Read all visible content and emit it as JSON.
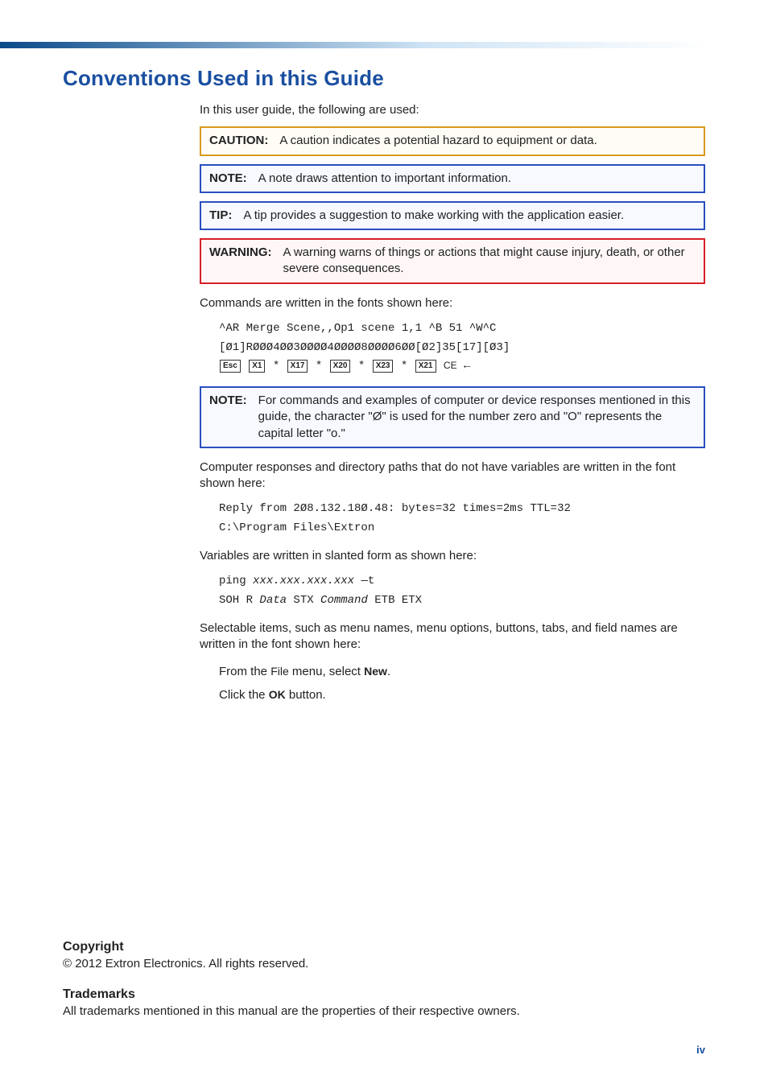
{
  "heading": "Conventions Used in this Guide",
  "intro": "In this user guide, the following are used:",
  "callouts": {
    "caution_label": "CAUTION:",
    "caution_text": "A caution indicates a potential hazard to equipment or data.",
    "note1_label": "NOTE:",
    "note1_text": "A note draws attention to important information.",
    "tip_label": "TIP:",
    "tip_text": "A tip provides a suggestion to make working with the application easier.",
    "warning_label": "WARNING:",
    "warning_text": "A warning warns of things or actions that might cause injury, death, or other severe consequences."
  },
  "commands_intro": "Commands are written in the fonts shown here:",
  "command_line1": "^AR Merge Scene,,Op1 scene 1,1 ^B 51 ^W^C",
  "command_line2": "[Ø1]RØØØ4ØØ3ØØØØ4ØØØØ8ØØØØ6ØØ[Ø2]35[17][Ø3]",
  "keys": {
    "esc": "Esc",
    "x1": "X1",
    "x17": "X17",
    "x20": "X20",
    "x23": "X23",
    "x21": "X21",
    "ce": "CE"
  },
  "note2_label": "NOTE:",
  "note2_text": "For commands and examples of computer or device responses mentioned in this guide, the character \"Ø\" is used for the number zero and \"O\" represents the capital letter \"o.\"",
  "responses_intro": "Computer responses and directory paths that do not have variables are written in the font shown here:",
  "response_line1": "Reply from 2Ø8.132.18Ø.48: bytes=32 times=2ms TTL=32",
  "response_line2": "C:\\Program Files\\Extron",
  "variables_intro": "Variables are written in slanted form as shown here:",
  "var_line1_a": "ping ",
  "var_line1_b": "xxx.xxx.xxx.xxx",
  "var_line1_c": " —t",
  "var_line2_a": "SOH R ",
  "var_line2_b": "Data",
  "var_line2_c": " STX ",
  "var_line2_d": "Command",
  "var_line2_e": " ETB ETX",
  "selectable_intro": "Selectable items, such as menu names, menu options, buttons, tabs, and field names are written in the font shown here:",
  "sel_line1_a": "From the ",
  "sel_line1_b": "File",
  "sel_line1_c": " menu, select ",
  "sel_line1_d": "New",
  "sel_line1_e": ".",
  "sel_line2_a": "Click the ",
  "sel_line2_b": "OK",
  "sel_line2_c": " button.",
  "copyright_h": "Copyright",
  "copyright_t": "© 2012 Extron Electronics. All rights reserved.",
  "trademarks_h": "Trademarks",
  "trademarks_t": "All trademarks mentioned in this manual are the properties of their respective owners.",
  "pagenum": "iv"
}
